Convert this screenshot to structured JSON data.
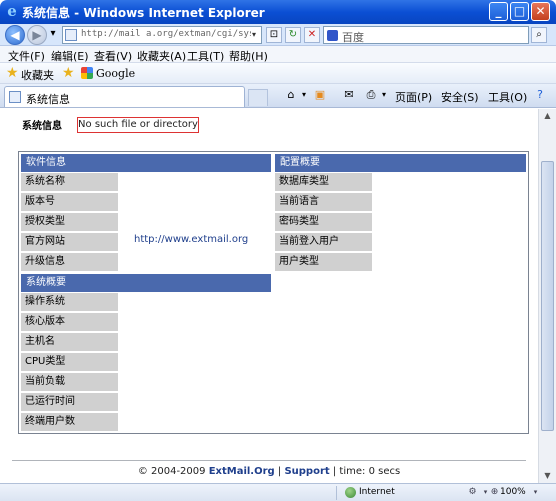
{
  "window": {
    "title": "系统信息 - Windows Internet Explorer",
    "buttons": {
      "minimize": "_",
      "maximize": "□",
      "close": "✕"
    }
  },
  "address_bar": {
    "url": "http://mail a.org/extman/cgi/sysinfo.c",
    "search_placeholder": "百度"
  },
  "menu": [
    "文件(F)",
    "编辑(E)",
    "查看(V)",
    "收藏夹(A)",
    "工具(T)",
    "帮助(H)"
  ],
  "favorites": {
    "favorites_label": "收藏夹",
    "google_label": "Google"
  },
  "tab": {
    "label": "系统信息"
  },
  "commands": {
    "page": "页面(P)",
    "safety": "安全(S)",
    "tools": "工具(O)"
  },
  "page": {
    "title": "系统信息",
    "error": "No such file or directory",
    "software": {
      "header": "软件信息",
      "rows": [
        "系统名称",
        "版本号",
        "授权类型",
        "官方网站",
        "升级信息"
      ],
      "link": "http://www.extmail.org"
    },
    "config": {
      "header": "配置概要",
      "rows": [
        "数据库类型",
        "当前语言",
        "密码类型",
        "当前登入用户",
        "用户类型"
      ]
    },
    "system": {
      "header": "系统概要",
      "rows": [
        "操作系统",
        "核心版本",
        "主机名",
        "CPU类型",
        "当前负载",
        "已运行时间",
        "终端用户数"
      ]
    },
    "footer": {
      "copyright": "© 2004-2009",
      "brand": "ExtMail.Org",
      "sep1": "|",
      "support": "Support",
      "sep2": "| time: 0 secs"
    }
  },
  "status_bar": {
    "zone": "Internet",
    "zoom": "100%"
  }
}
